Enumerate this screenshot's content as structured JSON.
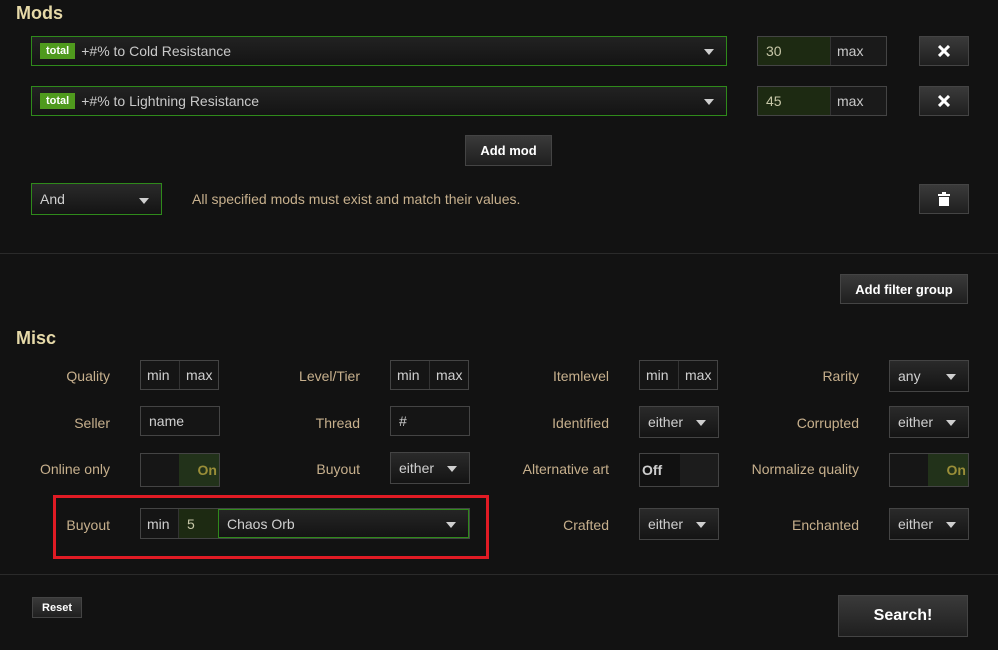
{
  "mods": {
    "title": "Mods",
    "rows": [
      {
        "tag": "total",
        "text": "+#% to Cold Resistance",
        "value": "30",
        "max": "max"
      },
      {
        "tag": "total",
        "text": "+#% to Lightning Resistance",
        "value": "45",
        "max": "max"
      }
    ],
    "add_mod": "Add mod",
    "logic": "And",
    "logic_desc": "All specified mods must exist and match their values."
  },
  "add_filter_group": "Add filter group",
  "misc": {
    "title": "Misc",
    "quality": {
      "label": "Quality",
      "min": "min",
      "max": "max"
    },
    "level": {
      "label": "Level/Tier",
      "min": "min",
      "max": "max"
    },
    "itemlevel": {
      "label": "Itemlevel",
      "min": "min",
      "max": "max"
    },
    "rarity": {
      "label": "Rarity",
      "value": "any"
    },
    "seller": {
      "label": "Seller",
      "placeholder": "name"
    },
    "thread": {
      "label": "Thread",
      "placeholder": "#"
    },
    "identified": {
      "label": "Identified",
      "value": "either"
    },
    "corrupted": {
      "label": "Corrupted",
      "value": "either"
    },
    "online": {
      "label": "Online only",
      "state": "On"
    },
    "buyout_toggle": {
      "label": "Buyout",
      "value": "either"
    },
    "alt_art": {
      "label": "Alternative art",
      "state": "Off"
    },
    "normalize": {
      "label": "Normalize quality",
      "state": "On"
    },
    "buyout": {
      "label": "Buyout",
      "min": "min",
      "value": "5",
      "currency": "Chaos Orb"
    },
    "crafted": {
      "label": "Crafted",
      "value": "either"
    },
    "enchanted": {
      "label": "Enchanted",
      "value": "either"
    }
  },
  "reset": "Reset",
  "search": "Search!",
  "colors": {
    "accent_green": "#4f9a1d",
    "highlight_red": "#e01b24"
  }
}
